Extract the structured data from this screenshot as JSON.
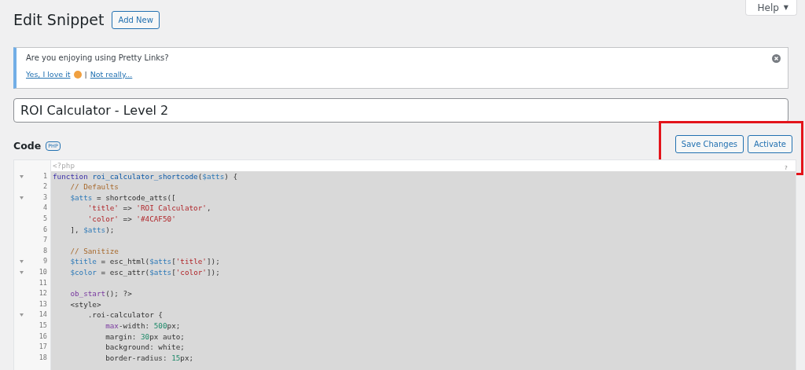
{
  "page_title": "Edit Snippet",
  "add_new_button": "Add New",
  "help_tab": {
    "label": "Help",
    "caret": "▼"
  },
  "notice": {
    "question": "Are you enjoying using Pretty Links?",
    "yes_link": "Yes, I love it",
    "separator": "|",
    "no_link": "Not really..."
  },
  "snippet_title": {
    "value": "ROI Calculator - Level 2"
  },
  "code_section": {
    "label": "Code",
    "badge": "PHP",
    "buttons": [
      "Save Changes",
      "Activate"
    ]
  },
  "editor": {
    "opening_tag": "<?php",
    "help_mark": "?",
    "lines": [
      {
        "number": "1",
        "fold": true,
        "tokens": [
          {
            "text": "function ",
            "kind": "kw"
          },
          {
            "text": "roi_calculator_shortcode",
            "kind": "def"
          },
          {
            "text": "(",
            "kind": "p"
          },
          {
            "text": "$atts",
            "kind": "var"
          },
          {
            "text": ") {",
            "kind": "p"
          }
        ]
      },
      {
        "number": "2",
        "fold": false,
        "tokens": [
          {
            "text": "    // Defaults",
            "kind": "cm"
          }
        ]
      },
      {
        "number": "3",
        "fold": true,
        "tokens": [
          {
            "text": "    $atts",
            "kind": "var"
          },
          {
            "text": " = shortcode_atts([",
            "kind": "p"
          }
        ]
      },
      {
        "number": "4",
        "fold": false,
        "tokens": [
          {
            "text": "        'title'",
            "kind": "str"
          },
          {
            "text": " => ",
            "kind": "p"
          },
          {
            "text": "'ROI Calculator'",
            "kind": "str"
          },
          {
            "text": ",",
            "kind": "p"
          }
        ]
      },
      {
        "number": "5",
        "fold": false,
        "tokens": [
          {
            "text": "        'color'",
            "kind": "str"
          },
          {
            "text": " => ",
            "kind": "p"
          },
          {
            "text": "'#4CAF50'",
            "kind": "str"
          }
        ]
      },
      {
        "number": "6",
        "fold": false,
        "tokens": [
          {
            "text": "    ], ",
            "kind": "p"
          },
          {
            "text": "$atts",
            "kind": "var"
          },
          {
            "text": ");",
            "kind": "p"
          }
        ]
      },
      {
        "number": "7",
        "fold": false
      },
      {
        "number": "8",
        "fold": false,
        "tokens": [
          {
            "text": "    // Sanitize",
            "kind": "cm"
          }
        ]
      },
      {
        "number": "9",
        "fold": true,
        "tokens": [
          {
            "text": "    $title",
            "kind": "var"
          },
          {
            "text": " = esc_html(",
            "kind": "p"
          },
          {
            "text": "$atts",
            "kind": "var"
          },
          {
            "text": "[",
            "kind": "p"
          },
          {
            "text": "'title'",
            "kind": "str"
          },
          {
            "text": "]);",
            "kind": "p"
          }
        ]
      },
      {
        "number": "10",
        "fold": true,
        "tokens": [
          {
            "text": "    $color",
            "kind": "var"
          },
          {
            "text": " = esc_attr(",
            "kind": "p"
          },
          {
            "text": "$atts",
            "kind": "var"
          },
          {
            "text": "[",
            "kind": "p"
          },
          {
            "text": "'color'",
            "kind": "str"
          },
          {
            "text": "]);",
            "kind": "p"
          }
        ]
      },
      {
        "number": "11",
        "fold": false
      },
      {
        "number": "12",
        "fold": false,
        "tokens": [
          {
            "text": "    ob_start",
            "kind": "bi"
          },
          {
            "text": "(); ?>",
            "kind": "p"
          }
        ]
      },
      {
        "number": "13",
        "fold": false,
        "tokens": [
          {
            "text": "    <style>",
            "kind": "p"
          }
        ]
      },
      {
        "number": "14",
        "fold": true,
        "tokens": [
          {
            "text": "        .roi-calculator {",
            "kind": "p"
          }
        ]
      },
      {
        "number": "15",
        "fold": false,
        "tokens": [
          {
            "text": "            max",
            "kind": "bi"
          },
          {
            "text": "-width: ",
            "kind": "p"
          },
          {
            "text": "500",
            "kind": "num"
          },
          {
            "text": "px;",
            "kind": "p"
          }
        ]
      },
      {
        "number": "16",
        "fold": false,
        "tokens": [
          {
            "text": "            margin: ",
            "kind": "p"
          },
          {
            "text": "30",
            "kind": "num"
          },
          {
            "text": "px auto;",
            "kind": "p"
          }
        ]
      },
      {
        "number": "17",
        "fold": false,
        "tokens": [
          {
            "text": "            background: white;",
            "kind": "p"
          }
        ]
      },
      {
        "number": "18",
        "fold": false,
        "tokens": [
          {
            "text": "            border-radius: ",
            "kind": "p"
          },
          {
            "text": "15",
            "kind": "num"
          },
          {
            "text": "px;",
            "kind": "p"
          }
        ]
      }
    ]
  }
}
